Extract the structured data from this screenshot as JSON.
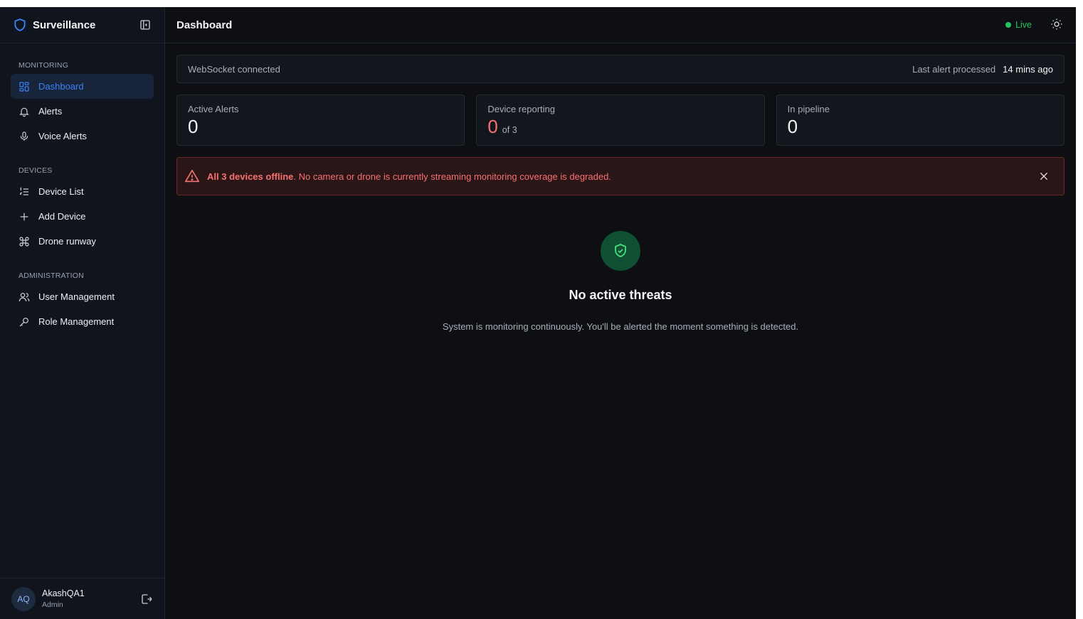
{
  "brand": {
    "title": "Surveillance"
  },
  "sidebar": {
    "sections": [
      {
        "title": "MONITORING",
        "items": [
          {
            "label": "Dashboard",
            "icon": "dashboard-icon",
            "active": true
          },
          {
            "label": "Alerts",
            "icon": "bell-icon"
          },
          {
            "label": "Voice Alerts",
            "icon": "microphone-icon"
          }
        ]
      },
      {
        "title": "DEVICES",
        "items": [
          {
            "label": "Device List",
            "icon": "list-icon"
          },
          {
            "label": "Add Device",
            "icon": "plus-icon"
          },
          {
            "label": "Drone runway",
            "icon": "drone-icon"
          }
        ]
      },
      {
        "title": "ADMINISTRATION",
        "items": [
          {
            "label": "User Management",
            "icon": "users-icon"
          },
          {
            "label": "Role Management",
            "icon": "key-icon"
          }
        ]
      }
    ],
    "user": {
      "initials": "AQ",
      "name": "AkashQA1",
      "role": "Admin"
    }
  },
  "header": {
    "title": "Dashboard",
    "live_label": "Live"
  },
  "ws": {
    "status": "WebSocket connected",
    "last_label": "Last alert processed",
    "last_value": "14 mins ago"
  },
  "stats": [
    {
      "label": "Active Alerts",
      "value": "0"
    },
    {
      "label": "Device reporting",
      "value": "0",
      "sub": "of 3"
    },
    {
      "label": "In pipeline",
      "value": "0"
    }
  ],
  "alert": {
    "strong": "All 3 devices offline",
    "text": ". No camera or drone is currently streaming monitoring coverage is degraded."
  },
  "empty": {
    "title": "No active threats",
    "desc": "System is monitoring continuously. You'll be alerted the moment something is detected."
  },
  "colors": {
    "accent": "#3b82f6",
    "live": "#22c55e",
    "danger": "#f87171",
    "safe": "#0f5132"
  }
}
